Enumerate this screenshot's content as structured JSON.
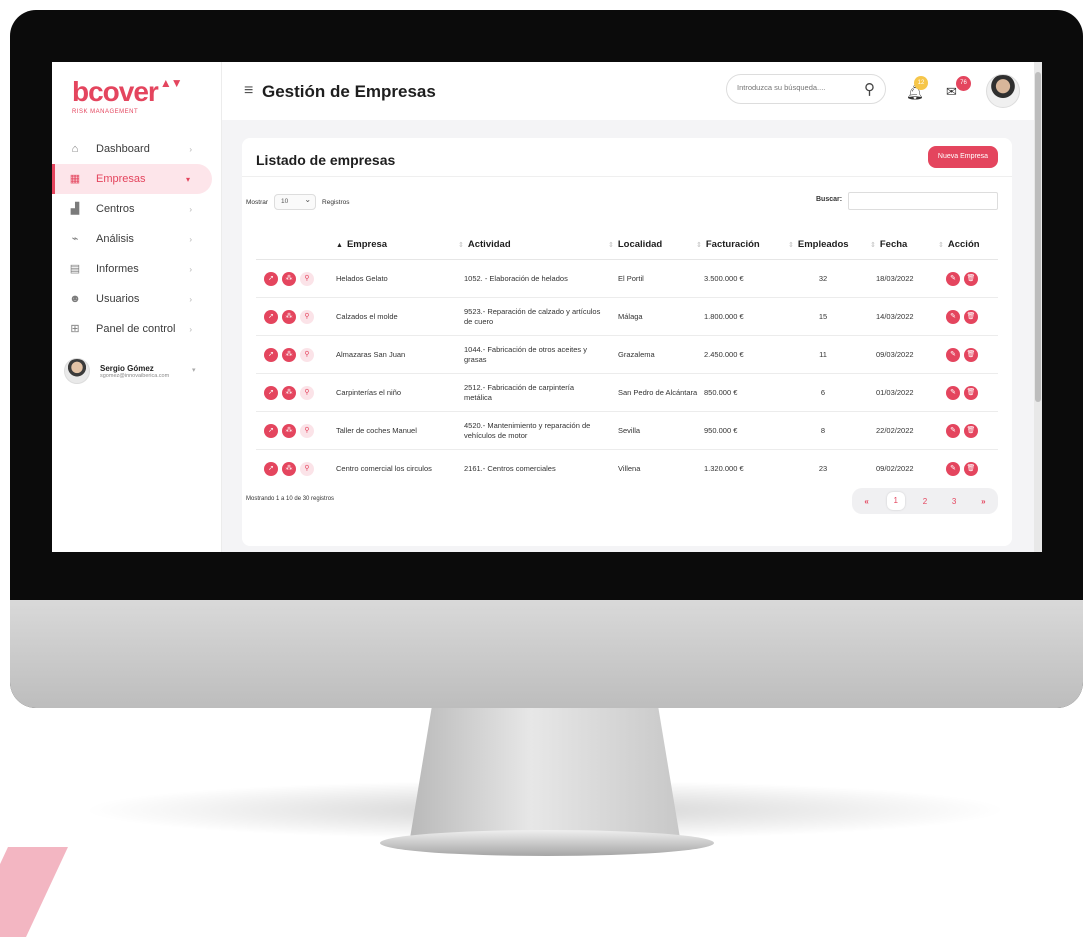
{
  "brand": {
    "logo_text": "bcover",
    "logo_mark": "▲▼",
    "logo_sub": "RISK MANAGEMENT"
  },
  "sidebar": {
    "items": [
      {
        "label": "Dashboard",
        "icon": "home-icon"
      },
      {
        "label": "Empresas",
        "icon": "building-icon",
        "active": true
      },
      {
        "label": "Centros",
        "icon": "factory-icon"
      },
      {
        "label": "Análisis",
        "icon": "chart-icon"
      },
      {
        "label": "Informes",
        "icon": "document-icon"
      },
      {
        "label": "Usuarios",
        "icon": "users-icon"
      },
      {
        "label": "Panel de control",
        "icon": "grid-icon"
      }
    ],
    "user": {
      "name": "Sergio Gómez",
      "email": "sgomez@innovaiberica.com"
    }
  },
  "header": {
    "title": "Gestión de Empresas",
    "search_placeholder": "Introduzca su búsqueda....",
    "notifications_count": "12",
    "messages_count": "76"
  },
  "card": {
    "title": "Listado de empresas",
    "new_button": "Nueva Empresa",
    "show_label": "Mostrar",
    "show_value": "10",
    "records_label": "Registros",
    "find_label": "Buscar:",
    "columns": [
      "Empresa",
      "Actividad",
      "Localidad",
      "Facturación",
      "Empleados",
      "Fecha",
      "Acción"
    ],
    "rows": [
      {
        "empresa": "Helados Gelato",
        "actividad": "1052. - Elaboración de helados",
        "localidad": "El Portil",
        "facturacion": "3.500.000 €",
        "empleados": "32",
        "fecha": "18/03/2022"
      },
      {
        "empresa": "Calzados el molde",
        "actividad": "9523.- Reparación de calzado y artículos de cuero",
        "localidad": "Málaga",
        "facturacion": "1.800.000 €",
        "empleados": "15",
        "fecha": "14/03/2022"
      },
      {
        "empresa": "Almazaras San Juan",
        "actividad": "1044.- Fabricación de otros aceites y grasas",
        "localidad": "Grazalema",
        "facturacion": "2.450.000 €",
        "empleados": "11",
        "fecha": "09/03/2022"
      },
      {
        "empresa": "Carpinterías el niño",
        "actividad": "2512.- Fabricación de carpintería metálica",
        "localidad": "San Pedro de Alcántara",
        "facturacion": "850.000 €",
        "empleados": "6",
        "fecha": "01/03/2022"
      },
      {
        "empresa": "Taller de coches Manuel",
        "actividad": "4520.- Mantenimiento y reparación de vehículos de motor",
        "localidad": "Sevilla",
        "facturacion": "950.000 €",
        "empleados": "8",
        "fecha": "22/02/2022"
      },
      {
        "empresa": "Centro comercial los circulos",
        "actividad": "2161.- Centros comerciales",
        "localidad": "Villena",
        "facturacion": "1.320.000 €",
        "empleados": "23",
        "fecha": "09/02/2022"
      }
    ],
    "footer_info": "Mostrando 1 a 10 de 30 registros",
    "pagination": {
      "first": "«",
      "pages": [
        "1",
        "2",
        "3"
      ],
      "last": "»",
      "current": "1"
    }
  },
  "colors": {
    "accent": "#e4455e",
    "accent_pale": "#fde5ea",
    "badge_yellow": "#f6c64a"
  }
}
